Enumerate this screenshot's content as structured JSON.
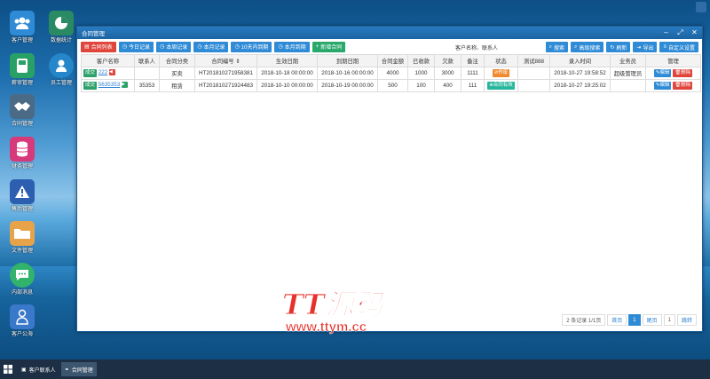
{
  "desktop_icons": [
    {
      "name": "客户管理",
      "icon": "users-icon",
      "color": "#2f8bd6"
    },
    {
      "name": "数据统计",
      "icon": "pie-chart-icon",
      "color": "#2a8a63"
    },
    {
      "name": "薪审管理",
      "icon": "phone-icon",
      "color": "#29a065"
    },
    {
      "name": "员工管理",
      "icon": "person-icon",
      "color": "#2587c9"
    },
    {
      "name": "合同管理",
      "icon": "handshake-icon",
      "color": "#4b6a86"
    },
    {
      "name": "财务管理",
      "icon": "database-icon",
      "color": "#d63a7a"
    },
    {
      "name": "售后管理",
      "icon": "warning-icon",
      "color": "#2c5fb0"
    },
    {
      "name": "文件管理",
      "icon": "folder-icon",
      "color": "#e7a34a"
    },
    {
      "name": "内部消息",
      "icon": "chat-icon",
      "color": "#31b36b"
    },
    {
      "name": "客户公海",
      "icon": "user-icon",
      "color": "#3a78c9"
    }
  ],
  "window": {
    "title": "合同管理",
    "toolbar": {
      "buttons": [
        "合同列表",
        "今日记录",
        "本周记录",
        "本月记录",
        "10天内到期",
        "本月到期",
        "新增合同"
      ],
      "search_placeholder": "客户名称、联系人",
      "right_buttons": [
        "搜索",
        "高级搜索",
        "刷新",
        "导出",
        "自定义设置"
      ]
    },
    "table": {
      "headers": [
        "客户名称",
        "联系人",
        "合同分类",
        "合同编号",
        "生效日期",
        "到期日期",
        "合同金额",
        "已收款",
        "欠款",
        "备注",
        "状态",
        "测试888",
        "录入时间",
        "业务员",
        "管理"
      ],
      "rows": [
        {
          "deal_tag": "成交",
          "customer": "222",
          "contact": "",
          "category": "买卖",
          "number": "HT201810271958381",
          "start": "2018-10-18 00:00:00",
          "end": "2018-10-16 00:00:00",
          "amount": "4000",
          "received": "1000",
          "debt": "3000",
          "note": "1111",
          "status": "作废",
          "test": "",
          "created": "2018-10-27 19:58:52",
          "salesman": "超级管理员",
          "edit": "编辑",
          "delete": "删除"
        },
        {
          "deal_tag": "成交",
          "customer": "5635353",
          "contact": "35353",
          "category": "租赁",
          "number": "HT201810271924483",
          "start": "2018-10-10 00:00:00",
          "end": "2018-10-19 00:00:00",
          "amount": "500",
          "received": "100",
          "debt": "400",
          "note": "111",
          "status": "合同有效",
          "test": "",
          "created": "2018-10-27 19:25:02",
          "salesman": "",
          "edit": "编辑",
          "delete": "删除"
        }
      ]
    },
    "pager": {
      "info": "2 条记录 1/1页",
      "first": "首页",
      "current": "1",
      "last": "尾页",
      "page_input": "1",
      "go": "跳转"
    }
  },
  "watermark": {
    "title": "TT源码",
    "url": "www.ttym.cc"
  },
  "taskbar": {
    "items": [
      "客户联系人",
      "合同管理"
    ]
  }
}
